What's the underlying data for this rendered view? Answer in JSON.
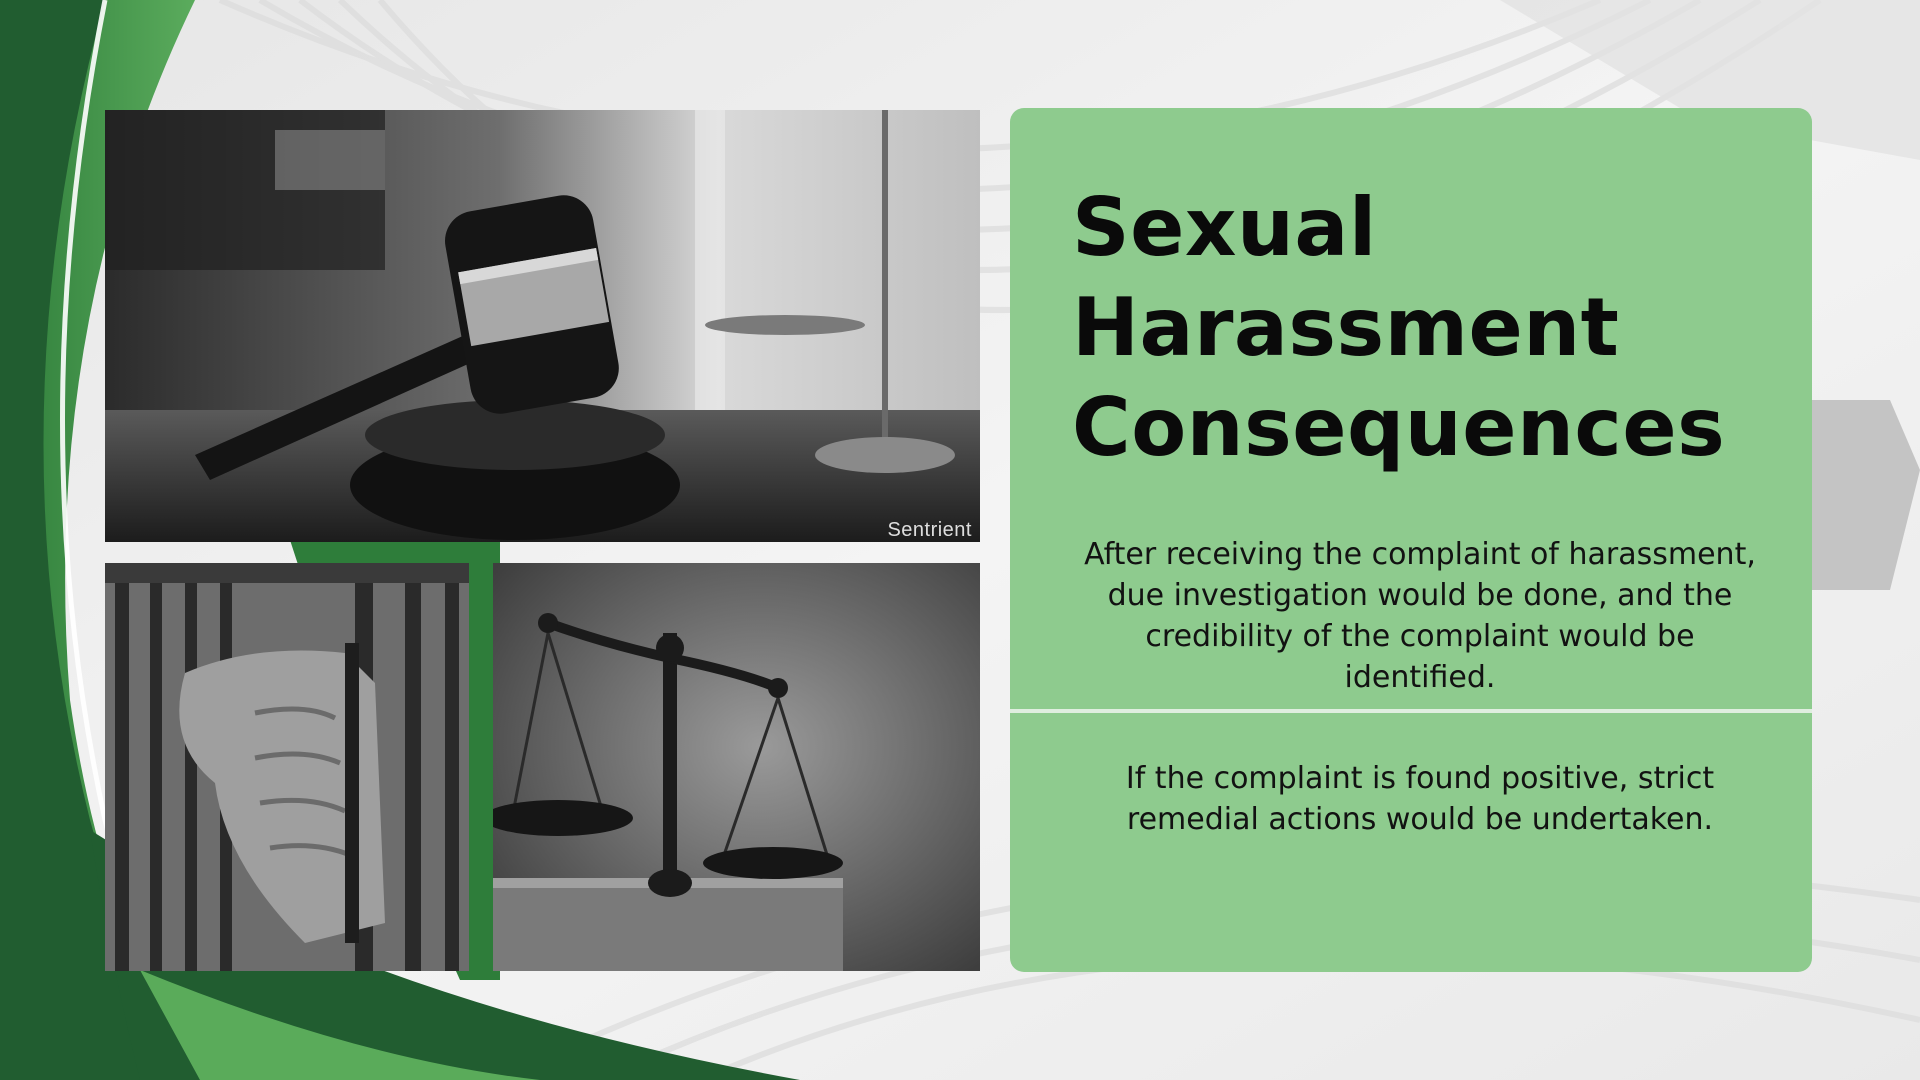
{
  "slide": {
    "title_lines": [
      "Sexual",
      "Harassment",
      "Consequences"
    ],
    "paragraph_1": "After receiving the complaint of harassment, due investigation would be done, and the credibility of the complaint would be identified.",
    "paragraph_2": "If the complaint is found positive, strict remedial actions would be undertaken."
  },
  "images": {
    "gavel_watermark": "Sentrient"
  },
  "colors": {
    "card_background": "#8ecb8e",
    "dark_green": "#1f5a2e",
    "mid_green": "#4a9a4e",
    "title_text": "#0a0a0a"
  }
}
